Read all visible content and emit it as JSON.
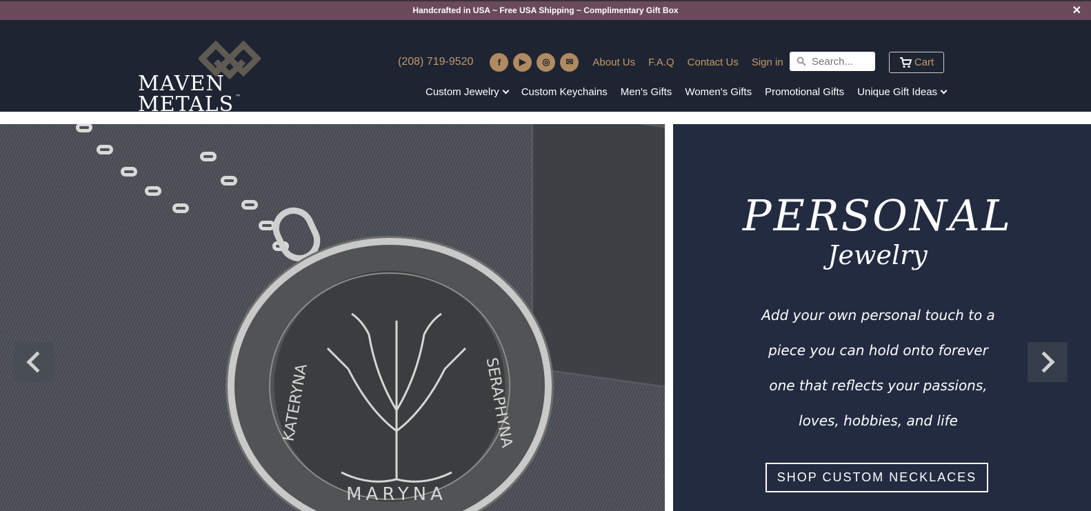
{
  "announcement": {
    "text": "Handcrafted in USA ~ Free USA Shipping ~ Complimentary Gift Box",
    "close": "✕"
  },
  "logo": {
    "text": "MAVEN METALS",
    "tm": "™"
  },
  "contact": {
    "phone": "(208) 719-9520"
  },
  "social": [
    {
      "icon": "facebook-icon",
      "glyph": "f"
    },
    {
      "icon": "youtube-icon",
      "glyph": "▶"
    },
    {
      "icon": "instagram-icon",
      "glyph": "◎"
    },
    {
      "icon": "email-icon",
      "glyph": "✉"
    }
  ],
  "toplinks": [
    "About Us",
    "F.A.Q",
    "Contact Us",
    "Sign in"
  ],
  "search": {
    "placeholder": "Search..."
  },
  "cart": {
    "label": "Cart"
  },
  "nav": [
    {
      "label": "Custom Jewelry",
      "dropdown": true
    },
    {
      "label": "Custom Keychains",
      "dropdown": false
    },
    {
      "label": "Men's Gifts",
      "dropdown": false
    },
    {
      "label": "Women's Gifts",
      "dropdown": false
    },
    {
      "label": "Promotional Gifts",
      "dropdown": false
    },
    {
      "label": "Unique Gift Ideas",
      "dropdown": true
    }
  ],
  "hero": {
    "engraving": [
      "KATERYNA",
      "MARYNA",
      "SERAPHYNA"
    ],
    "title": "PERSONAL",
    "subtitle": "Jewelry",
    "body": "Add your own personal touch to a piece you can hold onto forever one that reflects your passions, loves, hobbies, and life",
    "cta": "SHOP CUSTOM NECKLACES"
  },
  "colors": {
    "topbar": "#6b4a5c",
    "header": "#1e2432",
    "accent": "#c59a6b",
    "panel": "#222b40"
  }
}
